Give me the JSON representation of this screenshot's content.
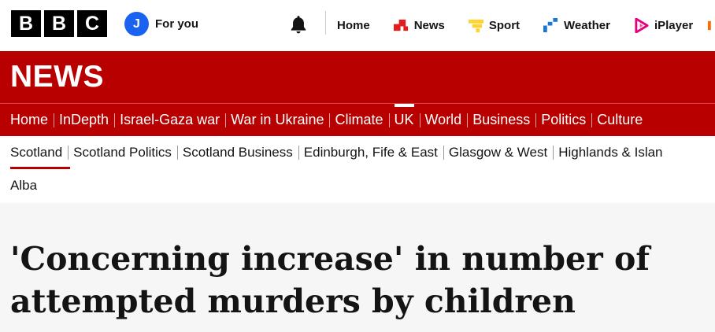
{
  "brand": {
    "letters": [
      "B",
      "B",
      "C"
    ]
  },
  "for_you": {
    "avatar_initial": "J",
    "label": "For you"
  },
  "top_nav": [
    {
      "label": "Home",
      "icon": "none"
    },
    {
      "label": "News",
      "icon": "news-icon",
      "color": "#e31d1d"
    },
    {
      "label": "Sport",
      "icon": "sport-icon",
      "color": "#ffd230"
    },
    {
      "label": "Weather",
      "icon": "weather-icon",
      "color": "#1a78d2"
    },
    {
      "label": "iPlayer",
      "icon": "iplayer-icon",
      "color": "#e5007e"
    }
  ],
  "section_title": "NEWS",
  "main_nav": [
    "Home",
    "InDepth",
    "Israel-Gaza war",
    "War in Ukraine",
    "Climate",
    "UK",
    "World",
    "Business",
    "Politics",
    "Culture"
  ],
  "main_nav_active": "UK",
  "sub_nav": [
    "Scotland",
    "Scotland Politics",
    "Scotland Business",
    "Edinburgh, Fife & East",
    "Glasgow & West",
    "Highlands & Islan"
  ],
  "sub_nav_active": "Scotland",
  "sub_nav_row2": [
    "Alba"
  ],
  "headline": "'Concerning increase' in number of attempted murders by children",
  "colors": {
    "news_red": "#b80000",
    "avatar_blue": "#1a63f1"
  }
}
